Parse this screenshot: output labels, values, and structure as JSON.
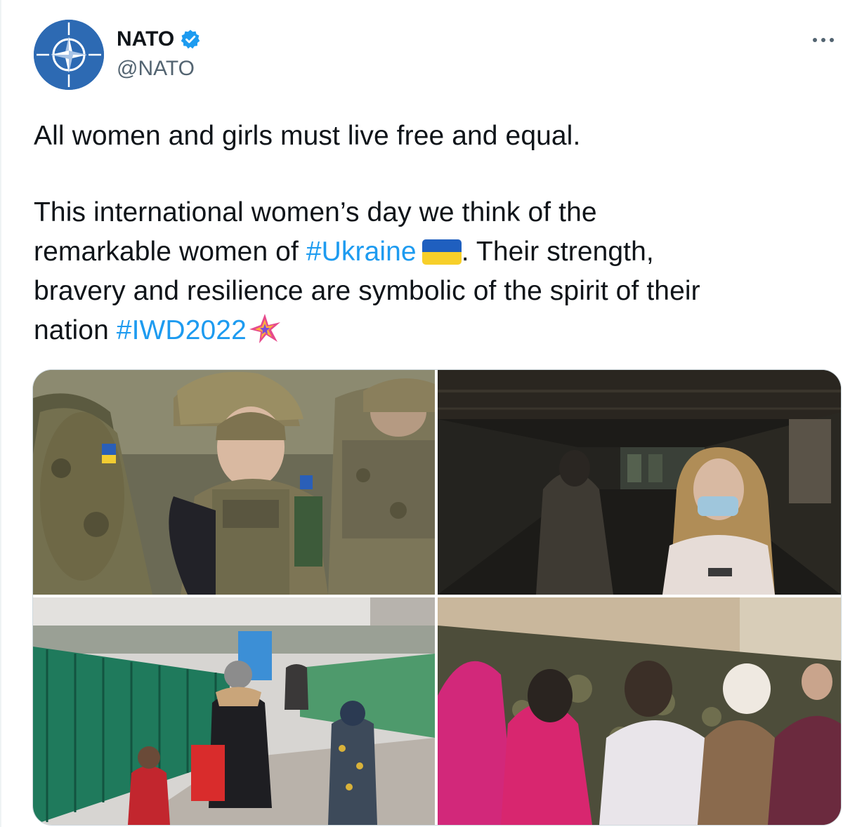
{
  "account": {
    "display_name": "NATO",
    "handle": "@NATO",
    "avatar_icon": "nato-compass-rose-icon",
    "verified_icon": "verified-badge-icon"
  },
  "tweet": {
    "line1": "All women and girls must live free and equal.",
    "p2_a": "This international women’s day we think of the",
    "p2_b": "remarkable women of ",
    "hashtag_ukraine": "#Ukraine",
    "p2_c": ". Their strength,",
    "p2_d": "bravery and resilience are symbolic of the spirit of their",
    "p2_e": "nation ",
    "hashtag_iwd": "#IWD2022",
    "flag_icon": "ukraine-flag-icon",
    "iwd_icon": "iwd-star-icon"
  },
  "colors": {
    "text": "#0f1419",
    "secondary": "#536471",
    "link": "#1d9bf0",
    "nato_blue": "#2d6ab3"
  },
  "media": {
    "count": 4
  }
}
